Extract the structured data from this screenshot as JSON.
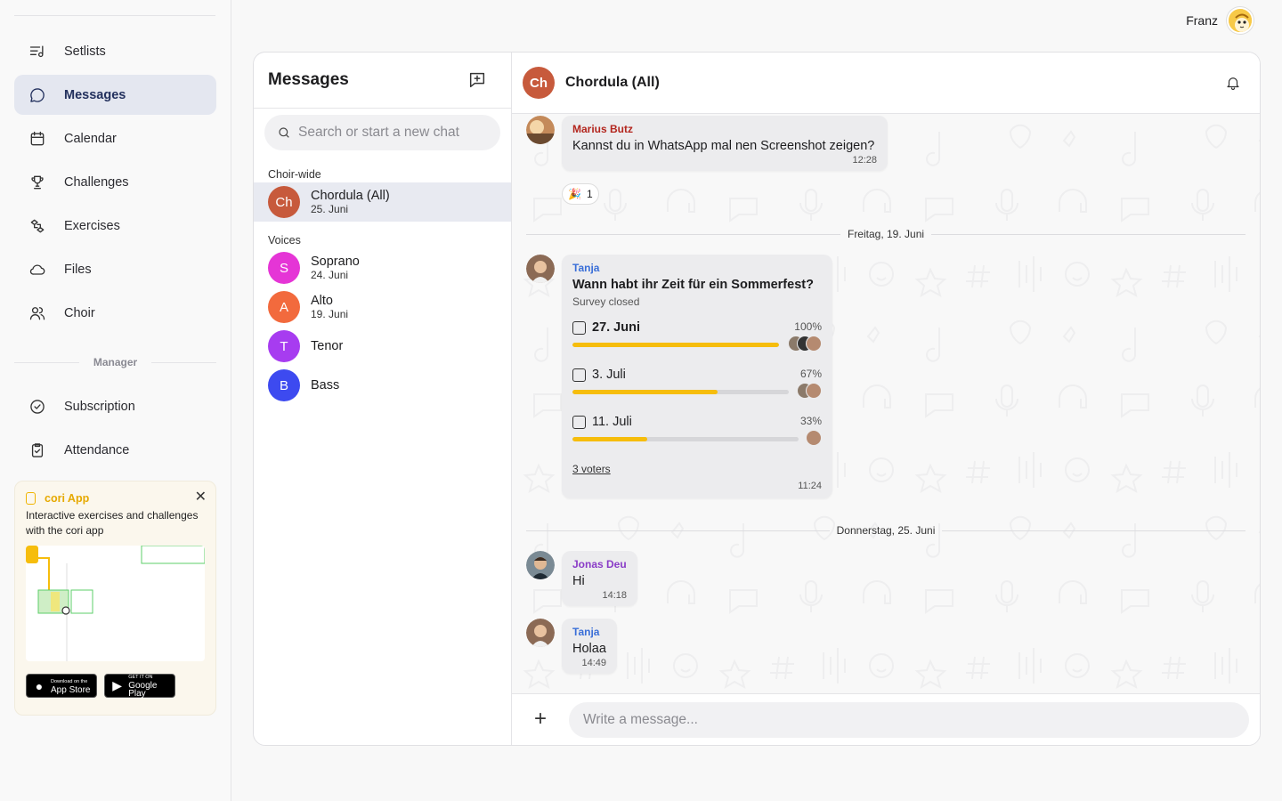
{
  "sidebar": {
    "items": [
      {
        "label": "Setlists",
        "icon": "setlist-icon"
      },
      {
        "label": "Messages",
        "icon": "chat-bubble-icon",
        "active": true
      },
      {
        "label": "Calendar",
        "icon": "calendar-icon"
      },
      {
        "label": "Challenges",
        "icon": "trophy-icon"
      },
      {
        "label": "Exercises",
        "icon": "exercises-icon"
      },
      {
        "label": "Files",
        "icon": "cloud-icon"
      },
      {
        "label": "Choir",
        "icon": "users-icon"
      }
    ],
    "section_label": "Manager",
    "manager_items": [
      {
        "label": "Subscription",
        "icon": "check-circle-icon"
      },
      {
        "label": "Attendance",
        "icon": "clipboard-check-icon"
      }
    ],
    "promo": {
      "title": "cori App",
      "text": "Interactive exercises and challenges with the cori app",
      "appstore_small": "Download on the",
      "appstore": "App Store",
      "googleplay_small": "GET IT ON",
      "googleplay": "Google Play"
    }
  },
  "user": {
    "name": "Franz"
  },
  "messages_panel": {
    "title": "Messages",
    "search_placeholder": "Search or start a new chat",
    "groups": [
      {
        "label": "Choir-wide",
        "chats": [
          {
            "initials": "Ch",
            "name": "Chordula (All)",
            "date": "25. Juni",
            "color": "#c75a3c",
            "active": true
          }
        ]
      },
      {
        "label": "Voices",
        "chats": [
          {
            "initials": "S",
            "name": "Soprano",
            "date": "24. Juni",
            "color": "#e535d6"
          },
          {
            "initials": "A",
            "name": "Alto",
            "date": "19. Juni",
            "color": "#f26a3d"
          },
          {
            "initials": "T",
            "name": "Tenor",
            "date": "",
            "color": "#a73cf0"
          },
          {
            "initials": "B",
            "name": "Bass",
            "date": "",
            "color": "#3d4af0"
          }
        ]
      }
    ]
  },
  "conversation": {
    "initials": "Ch",
    "title": "Chordula (All)",
    "messages": [
      {
        "sender": "Marius Butz",
        "sender_color": "#b3261e",
        "text": "Kannst du in WhatsApp mal nen Screenshot zeigen?",
        "time": "12:28",
        "reaction_emoji": "🎉",
        "reaction_count": "1"
      },
      {
        "sender": "Jonas Deu",
        "sender_color": "#8a3cc7",
        "text": "Hi",
        "time": "14:18"
      },
      {
        "sender": "Tanja",
        "sender_color": "#3a6fd8",
        "text": "Holaa",
        "time": "14:49"
      }
    ],
    "day_separators": [
      "Freitag, 19. Juni",
      "Donnerstag, 25. Juni"
    ],
    "poll": {
      "sender": "Tanja",
      "sender_color": "#3a6fd8",
      "question": "Wann habt ihr Zeit für ein Sommerfest?",
      "status": "Survey closed",
      "options": [
        {
          "label": "27. Juni",
          "percent": "100%",
          "value": 1.0,
          "bold": true
        },
        {
          "label": "3. Juli",
          "percent": "67%",
          "value": 0.67
        },
        {
          "label": "11. Juli",
          "percent": "33%",
          "value": 0.33
        }
      ],
      "voters": "3 voters",
      "time": "11:24"
    },
    "compose_placeholder": "Write a message..."
  }
}
